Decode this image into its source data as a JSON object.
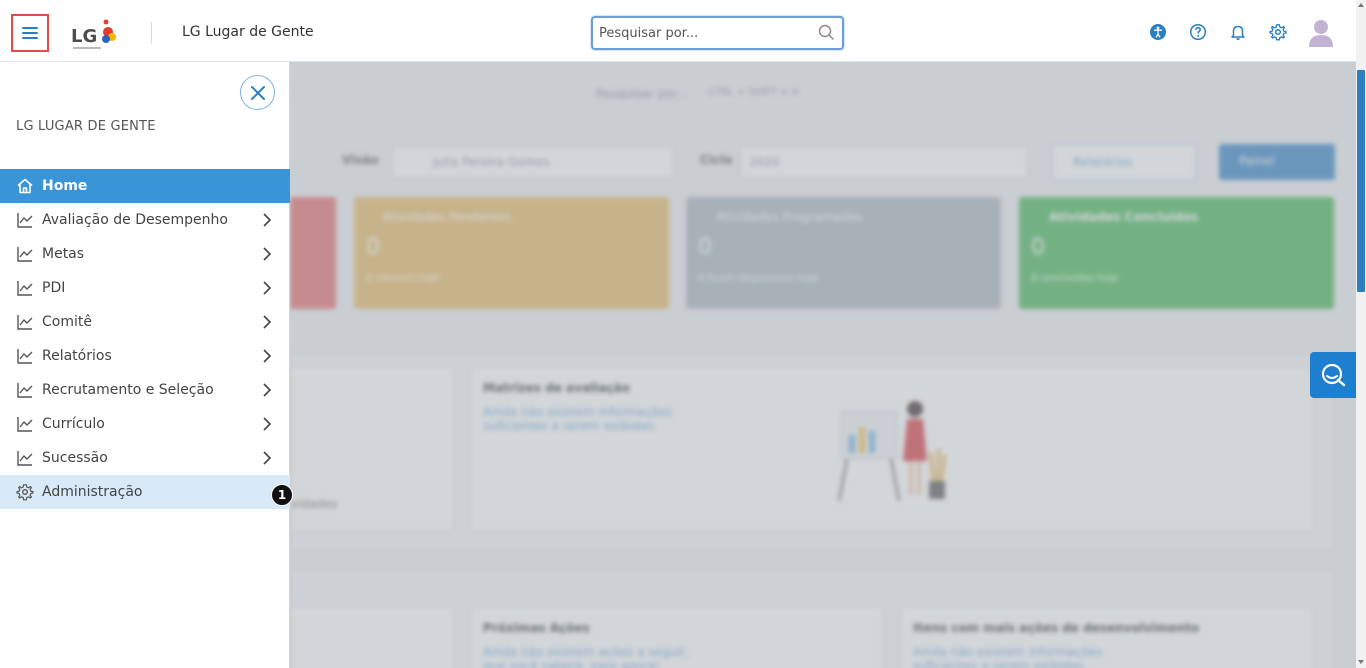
{
  "header": {
    "app_title": "LG Lugar de Gente",
    "logo_text": "LG",
    "search_placeholder": "Pesquisar por...",
    "icons": [
      "accessibility-icon",
      "help-icon",
      "bell-icon",
      "gear-icon",
      "avatar"
    ]
  },
  "sidebar": {
    "company": "LG LUGAR DE GENTE",
    "items": [
      {
        "label": "Home",
        "icon": "home-icon",
        "active": true,
        "has_chevron": false
      },
      {
        "label": "Avaliação de Desempenho",
        "icon": "chart-line-icon",
        "has_chevron": true
      },
      {
        "label": "Metas",
        "icon": "chart-line-icon",
        "has_chevron": true
      },
      {
        "label": "PDI",
        "icon": "chart-line-icon",
        "has_chevron": true
      },
      {
        "label": "Comitê",
        "icon": "chart-line-icon",
        "has_chevron": true
      },
      {
        "label": "Relatórios",
        "icon": "chart-line-icon",
        "has_chevron": true
      },
      {
        "label": "Recrutamento e Seleção",
        "icon": "chart-line-icon",
        "has_chevron": true
      },
      {
        "label": "Currículo",
        "icon": "chart-line-icon",
        "has_chevron": true
      },
      {
        "label": "Sucessão",
        "icon": "chart-line-icon",
        "has_chevron": true
      },
      {
        "label": "Administração",
        "icon": "gear-icon",
        "highlighted": true,
        "has_chevron": false
      }
    ],
    "step_badge": "1"
  },
  "background": {
    "search_placeholder": "Pesquisar por...",
    "search_shortcut": "CTRL + SHIFT + X",
    "view_label": "Visão",
    "view_value": "Julia Pereira Gomes",
    "cycle_label": "Ciclo",
    "cycle_value": "2020",
    "reports_button": "Relatórios",
    "panel_button": "Painel",
    "cards": [
      {
        "title": "Atividades Pendentes",
        "value": "0",
        "sub": "0 vencem hoje",
        "color": "#e8b860"
      },
      {
        "title": "Atividades Programadas",
        "value": "0",
        "sub": "0 ficam disponíveis hoje",
        "color": "#a9b3be"
      },
      {
        "title": "Atividades Concluídas",
        "value": "0",
        "sub": "0 concluídas hoje",
        "color": "#3fb553"
      }
    ],
    "red_card_color": "#e46a6a",
    "matrix_title": "Matrizes de avaliação",
    "matrix_text": "Ainda não existem informações suficientes a serem exibidas.",
    "actions_title": "Próximas Ações",
    "actions_text": "Ainda não existem ações a seguir, que você saberá, pare agora!",
    "items_title": "Itens com mais ações de desenvolvimento",
    "items_text": "Ainda não existem informações suficientes a serem exibidas.",
    "activities_fragment": "vidades"
  }
}
